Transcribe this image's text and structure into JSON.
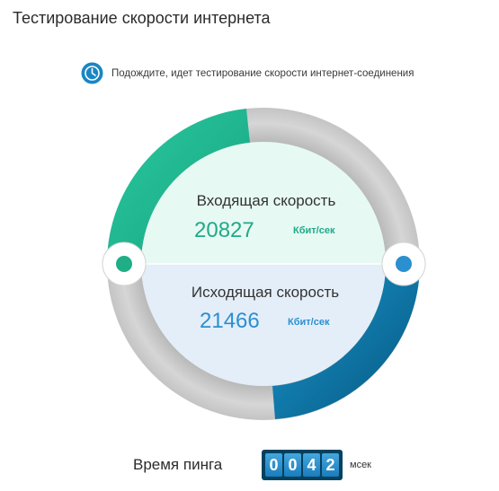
{
  "page": {
    "title": "Тестирование скорости интернета"
  },
  "status": {
    "icon": "clock-icon",
    "text": "Подождите, идет тестирование скорости интернет-соединения"
  },
  "gauge": {
    "download": {
      "label": "Входящая скорость",
      "value": "20827",
      "unit": "Кбит/сек",
      "color": "#21a98a"
    },
    "upload": {
      "label": "Исходящая скорость",
      "value": "21466",
      "unit": "Кбит/сек",
      "color": "#2b8fd0"
    }
  },
  "ping": {
    "label": "Время пинга",
    "digits": [
      "0",
      "0",
      "4",
      "2"
    ],
    "unit": "мсек"
  },
  "colors": {
    "track": "#c8c8c8",
    "download_panel": "#e6f9f2",
    "upload_panel": "#e4eef8",
    "download_arc": "#25b58e",
    "upload_arc": "#0f7bb3",
    "counter_bg": "#04415f"
  }
}
